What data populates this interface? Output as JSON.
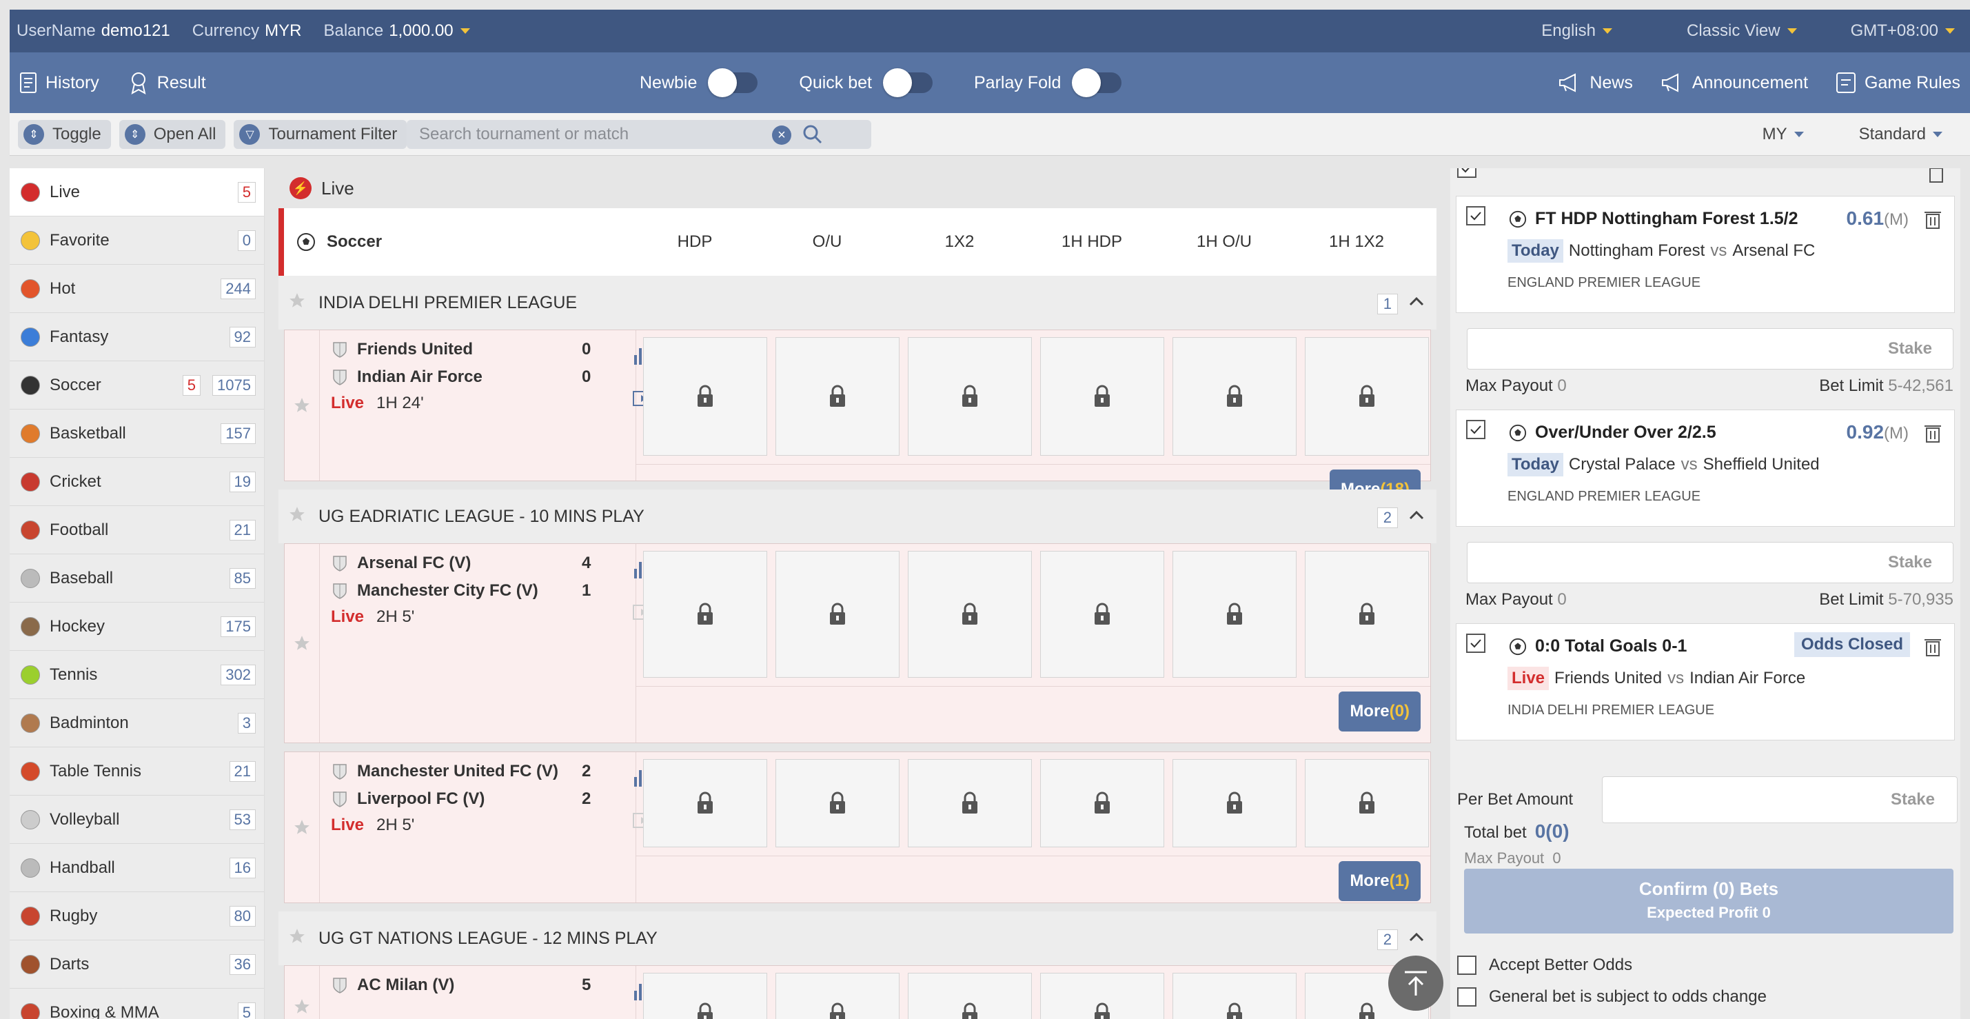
{
  "topbar": {
    "username_label": "UserName",
    "username": "demo121",
    "currency_label": "Currency",
    "currency": "MYR",
    "balance_label": "Balance",
    "balance": "1,000.00",
    "language": "English",
    "view": "Classic View",
    "timezone": "GMT+08:00"
  },
  "navbar": {
    "history": "History",
    "result": "Result",
    "newbie": "Newbie",
    "quick_bet": "Quick bet",
    "parlay_fold": "Parlay Fold",
    "news": "News",
    "announcement": "Announcement",
    "game_rules": "Game Rules"
  },
  "filterbar": {
    "toggle": "Toggle",
    "open_all": "Open All",
    "tournament_filter": "Tournament Filter",
    "search_placeholder": "Search tournament or match",
    "odds_format": "MY",
    "market_type": "Standard"
  },
  "sidebar": {
    "items": [
      {
        "label": "Live",
        "live": "",
        "count": "5",
        "icon": "live-icon",
        "color": "#d32d2d"
      },
      {
        "label": "Favorite",
        "live": "",
        "count": "0",
        "icon": "star-icon",
        "color": "#f3c33a"
      },
      {
        "label": "Hot",
        "live": "",
        "count": "244",
        "icon": "flame-icon",
        "color": "#e2552b"
      },
      {
        "label": "Fantasy",
        "live": "",
        "count": "92",
        "icon": "fantasy-icon",
        "color": "#3b7dd8"
      },
      {
        "label": "Soccer",
        "live": "5",
        "count": "1075",
        "icon": "soccer-icon",
        "color": "#333333"
      },
      {
        "label": "Basketball",
        "live": "",
        "count": "157",
        "icon": "basketball-icon",
        "color": "#e07b2c"
      },
      {
        "label": "Cricket",
        "live": "",
        "count": "19",
        "icon": "cricket-icon",
        "color": "#c83a2f"
      },
      {
        "label": "Football",
        "live": "",
        "count": "21",
        "icon": "football-helmet-icon",
        "color": "#c8452f"
      },
      {
        "label": "Baseball",
        "live": "",
        "count": "85",
        "icon": "baseball-icon",
        "color": "#bbbbbb"
      },
      {
        "label": "Hockey",
        "live": "",
        "count": "175",
        "icon": "hockey-icon",
        "color": "#8a6a4a"
      },
      {
        "label": "Tennis",
        "live": "",
        "count": "302",
        "icon": "tennis-icon",
        "color": "#9bcf2e"
      },
      {
        "label": "Badminton",
        "live": "",
        "count": "3",
        "icon": "badminton-icon",
        "color": "#b07a4f"
      },
      {
        "label": "Table Tennis",
        "live": "",
        "count": "21",
        "icon": "table-tennis-icon",
        "color": "#d44a2a"
      },
      {
        "label": "Volleyball",
        "live": "",
        "count": "53",
        "icon": "volleyball-icon",
        "color": "#cccccc"
      },
      {
        "label": "Handball",
        "live": "",
        "count": "16",
        "icon": "handball-icon",
        "color": "#bbbbbb"
      },
      {
        "label": "Rugby",
        "live": "",
        "count": "80",
        "icon": "rugby-icon",
        "color": "#c8452f"
      },
      {
        "label": "Darts",
        "live": "",
        "count": "36",
        "icon": "darts-icon",
        "color": "#a0522d"
      },
      {
        "label": "Boxing & MMA",
        "live": "",
        "count": "5",
        "icon": "boxing-icon",
        "color": "#c8452f"
      }
    ]
  },
  "main": {
    "live_label": "Live",
    "sport": "Soccer",
    "columns": [
      "HDP",
      "O/U",
      "1X2",
      "1H HDP",
      "1H O/U",
      "1H 1X2"
    ],
    "leagues": [
      {
        "name": "INDIA DELHI PREMIER LEAGUE",
        "count": "1"
      },
      {
        "name": "UG EADRIATIC LEAGUE - 10 MINS PLAY",
        "count": "2"
      },
      {
        "name": "UG GT NATIONS LEAGUE - 12 MINS PLAY",
        "count": "2"
      }
    ],
    "matches": [
      {
        "home": "Friends United",
        "away": "Indian Air Force",
        "home_score": "0",
        "away_score": "0",
        "live": "Live",
        "time": "1H 24'",
        "more_label": "More",
        "more_count": "(18)"
      },
      {
        "home": "Arsenal FC (V)",
        "away": "Manchester City FC (V)",
        "home_score": "4",
        "away_score": "1",
        "live": "Live",
        "time": "2H 5'",
        "more_label": "More",
        "more_count": "(0)"
      },
      {
        "home": "Manchester United FC (V)",
        "away": "Liverpool FC (V)",
        "home_score": "2",
        "away_score": "2",
        "live": "Live",
        "time": "2H 5'",
        "more_label": "More",
        "more_count": "(1)"
      },
      {
        "home": "AC Milan (V)",
        "away": "",
        "home_score": "5",
        "away_score": "",
        "live": "",
        "time": "",
        "more_label": "",
        "more_count": ""
      }
    ]
  },
  "betslip": {
    "bets": [
      {
        "title": "FT HDP Nottingham Forest 1.5/2",
        "odds": "0.61",
        "odds_type": "(M)",
        "tag": "Today",
        "home": "Nottingham Forest",
        "vs": "vs",
        "away": "Arsenal FC",
        "league": "ENGLAND PREMIER LEAGUE",
        "stake_placeholder": "Stake",
        "max_payout_label": "Max Payout",
        "max_payout": "0",
        "bet_limit_label": "Bet Limit",
        "bet_limit": "5-42,561"
      },
      {
        "title": "Over/Under Over 2/2.5",
        "odds": "0.92",
        "odds_type": "(M)",
        "tag": "Today",
        "home": "Crystal Palace",
        "vs": "vs",
        "away": "Sheffield United",
        "league": "ENGLAND PREMIER LEAGUE",
        "stake_placeholder": "Stake",
        "max_payout_label": "Max Payout",
        "max_payout": "0",
        "bet_limit_label": "Bet Limit",
        "bet_limit": "5-70,935"
      },
      {
        "title": "0:0 Total Goals 0-1",
        "status": "Odds Closed",
        "tag": "Live",
        "home": "Friends United",
        "vs": "vs",
        "away": "Indian Air Force",
        "league": "INDIA DELHI PREMIER LEAGUE"
      }
    ],
    "per_bet_label": "Per Bet Amount",
    "per_bet_placeholder": "Stake",
    "total_bet_label": "Total bet",
    "total_bet": "0(0)",
    "max_payout_label": "Max Payout",
    "max_payout": "0",
    "confirm_label": "Confirm (0) Bets",
    "expected_profit": "Expected Profit 0",
    "accept_better_odds": "Accept Better Odds",
    "general_bet_note": "General bet is subject to odds change"
  },
  "colors": {
    "header": "#3f5781",
    "nav": "#5874a3",
    "live_red": "#d32d2d",
    "accent_yellow": "#f3c33a"
  }
}
